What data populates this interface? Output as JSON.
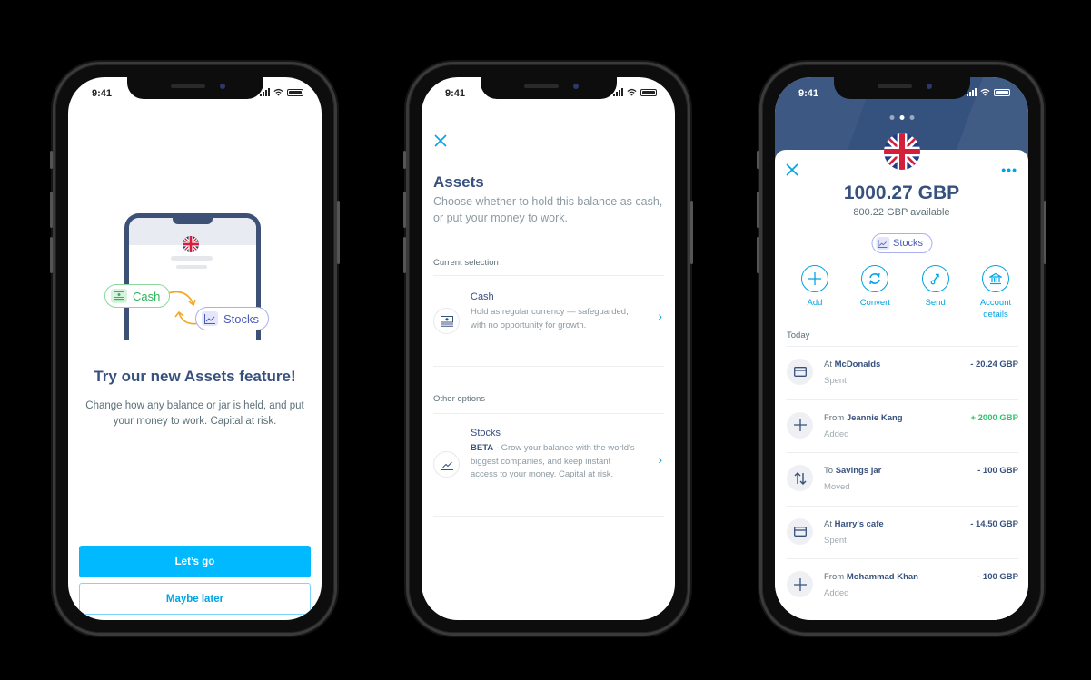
{
  "status_bar": {
    "time": "9:41"
  },
  "colors": {
    "primary": "#00b9ff",
    "navy": "#37517e",
    "positive": "#2ec36a",
    "cash_green": "#2fb55a",
    "stocks_purple": "#4a5ab8"
  },
  "phone1": {
    "illustration": {
      "cash_label": "Cash",
      "stocks_label": "Stocks",
      "flag_icon": "uk-flag-icon"
    },
    "title": "Try our new Assets feature!",
    "body": "Change how any balance or jar is held, and put your money to work. Capital at risk.",
    "primary_button": "Let’s go",
    "secondary_button": "Maybe later"
  },
  "phone2": {
    "close_icon": "close-icon",
    "title": "Assets",
    "subtitle": "Choose whether to hold this balance as cash, or put your money to work.",
    "current_label": "Current selection",
    "current_option": {
      "title": "Cash",
      "description": "Hold as regular currency — safeguarded, with no opportunity for growth.",
      "icon": "cash-icon"
    },
    "other_label": "Other options",
    "other_options": [
      {
        "title": "Stocks",
        "badge": "BETA",
        "description": " - Grow your balance with the world's biggest companies, and keep instant access to your money. Capital at risk.",
        "icon": "chart-icon"
      }
    ]
  },
  "phone3": {
    "pager": {
      "pages": 3,
      "active": 2
    },
    "balance": "1000.27 GBP",
    "available": "800.22 GBP available",
    "asset_chip": "Stocks",
    "actions": [
      {
        "label": "Add",
        "icon": "plus-icon"
      },
      {
        "label": "Convert",
        "icon": "convert-icon"
      },
      {
        "label": "Send",
        "icon": "send-icon"
      },
      {
        "label": "Account details",
        "icon": "bank-icon"
      }
    ],
    "section_label": "Today",
    "transactions": [
      {
        "prefix": "At",
        "name": "McDonalds",
        "status": "Spent",
        "amount": "- 20.24 GBP",
        "icon": "card-icon",
        "positive": false
      },
      {
        "prefix": "From",
        "name": "Jeannie Kang",
        "status": "Added",
        "amount": "+ 2000 GBP",
        "icon": "plus-icon",
        "positive": true
      },
      {
        "prefix": "To",
        "name": "Savings jar",
        "status": "Moved",
        "amount": "- 100 GBP",
        "icon": "transfer-icon",
        "positive": false
      },
      {
        "prefix": "At",
        "name": "Harry's cafe",
        "status": "Spent",
        "amount": "- 14.50 GBP",
        "icon": "card-icon",
        "positive": false
      },
      {
        "prefix": "From",
        "name": "Mohammad Khan",
        "status": "Added",
        "amount": "- 100 GBP",
        "icon": "plus-icon",
        "positive": false
      }
    ]
  }
}
